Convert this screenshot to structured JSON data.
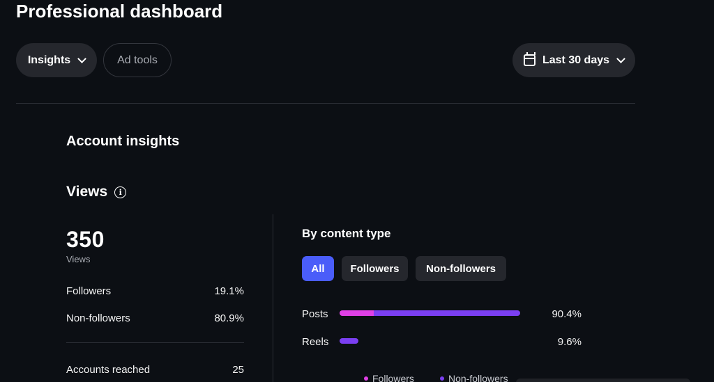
{
  "header": {
    "title": "Professional dashboard"
  },
  "toolbar": {
    "insights_label": "Insights",
    "adtools_label": "Ad tools",
    "range_label": "Last 30 days",
    "range_icon": "calendar-icon"
  },
  "account_insights": {
    "title": "Account insights",
    "views": {
      "heading": "Views",
      "total": "350",
      "total_label": "Views",
      "rows": [
        {
          "label": "Followers",
          "value": "19.1%"
        },
        {
          "label": "Non-followers",
          "value": "80.9%"
        },
        {
          "label": "Accounts reached",
          "value": "25"
        }
      ]
    }
  },
  "by_content_type": {
    "title": "By content type",
    "filters": [
      "All",
      "Followers",
      "Non-followers"
    ],
    "active_filter": "All",
    "bars": [
      {
        "label": "Posts",
        "value": "90.4%",
        "fraction_of_max": 1.0,
        "followers_fraction": 0.19
      },
      {
        "label": "Reels",
        "value": "9.6%",
        "fraction_of_max": 0.106,
        "followers_fraction": 0.0
      }
    ],
    "legend": [
      {
        "label": "Followers",
        "color": "#e040e6"
      },
      {
        "label": "Non-followers",
        "color": "#7b3ff2"
      }
    ]
  },
  "colors": {
    "accent": "#4a5df9",
    "followers": "#e040e6",
    "non_followers": "#7b3ff2",
    "background": "#0c0f14"
  }
}
